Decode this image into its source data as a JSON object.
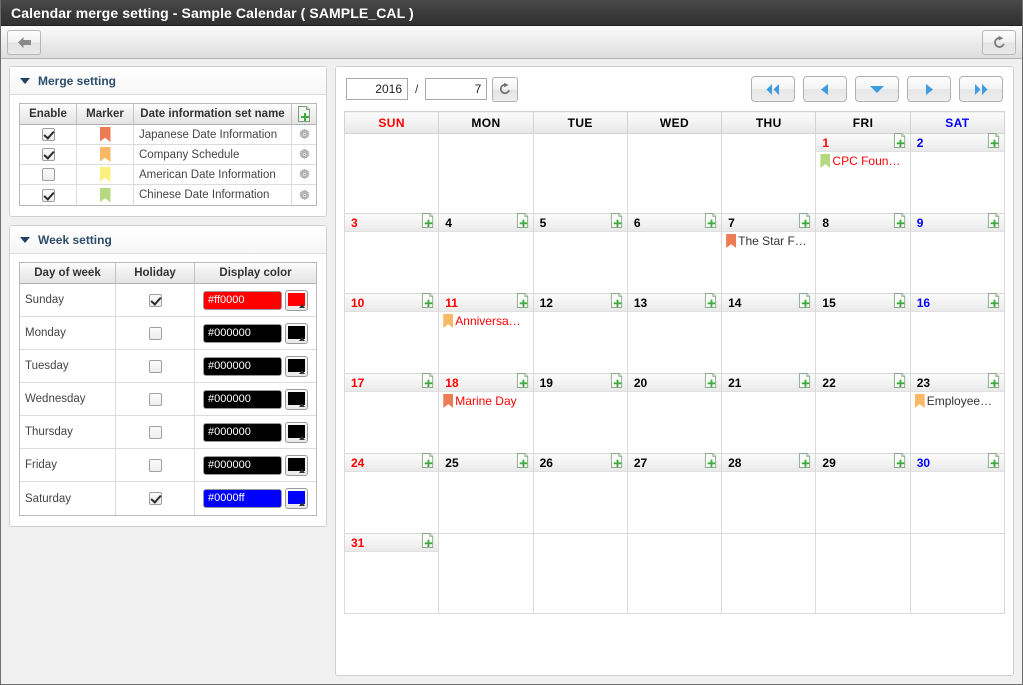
{
  "window": {
    "title": "Calendar merge setting - Sample Calendar ( SAMPLE_CAL )"
  },
  "toolbar": {
    "back_icon": "back-arrow-icon",
    "refresh_icon": "refresh-icon"
  },
  "merge_panel": {
    "title": "Merge setting",
    "collapse_icon": "caret-down-icon",
    "new_icon": "new-document-icon",
    "columns": [
      "Enable",
      "Marker",
      "Date information set name"
    ],
    "rows": [
      {
        "enabled": true,
        "marker_color": "#ed7b53",
        "name": "Japanese Date Information",
        "settings_icon": "gear-icon"
      },
      {
        "enabled": true,
        "marker_color": "#f9b866",
        "name": "Company Schedule",
        "settings_icon": "gear-icon"
      },
      {
        "enabled": false,
        "marker_color": "#fbf07e",
        "name": "American Date Information",
        "settings_icon": "gear-icon"
      },
      {
        "enabled": true,
        "marker_color": "#b5d97f",
        "name": "Chinese Date Information",
        "settings_icon": "gear-icon"
      }
    ]
  },
  "week_panel": {
    "title": "Week setting",
    "collapse_icon": "caret-down-icon",
    "columns": [
      "Day of week",
      "Holiday",
      "Display color"
    ],
    "rows": [
      {
        "day": "Sunday",
        "holiday": true,
        "color_value": "#ff0000",
        "color": "#ff0000"
      },
      {
        "day": "Monday",
        "holiday": false,
        "color_value": "#000000",
        "color": "#000000"
      },
      {
        "day": "Tuesday",
        "holiday": false,
        "color_value": "#000000",
        "color": "#000000"
      },
      {
        "day": "Wednesday",
        "holiday": false,
        "color_value": "#000000",
        "color": "#000000"
      },
      {
        "day": "Thursday",
        "holiday": false,
        "color_value": "#000000",
        "color": "#000000"
      },
      {
        "day": "Friday",
        "holiday": false,
        "color_value": "#000000",
        "color": "#000000"
      },
      {
        "day": "Saturday",
        "holiday": true,
        "color_value": "#0000ff",
        "color": "#0000ff"
      }
    ]
  },
  "calendar": {
    "year": "2016",
    "month": "7",
    "reload_icon": "refresh-icon",
    "nav": [
      {
        "name": "first-button",
        "icon": "double-left-icon"
      },
      {
        "name": "previous-button",
        "icon": "left-icon"
      },
      {
        "name": "today-button",
        "icon": "down-icon"
      },
      {
        "name": "next-button",
        "icon": "right-icon"
      },
      {
        "name": "last-button",
        "icon": "double-right-icon"
      }
    ],
    "weekday_headers": [
      {
        "label": "SUN",
        "color": "#ff0000"
      },
      {
        "label": "MON",
        "color": "#000000"
      },
      {
        "label": "TUE",
        "color": "#000000"
      },
      {
        "label": "WED",
        "color": "#000000"
      },
      {
        "label": "THU",
        "color": "#000000"
      },
      {
        "label": "FRI",
        "color": "#000000"
      },
      {
        "label": "SAT",
        "color": "#0000ff"
      }
    ],
    "add_icon": "add-event-icon",
    "weeks": [
      [
        {
          "blank": true
        },
        {
          "blank": true
        },
        {
          "blank": true
        },
        {
          "blank": true
        },
        {
          "blank": true
        },
        {
          "day": "1",
          "color": "#ff0000",
          "events": [
            {
              "marker_color": "#b5d97f",
              "title": "CPC Foun…",
              "color": "#ff0000"
            }
          ]
        },
        {
          "day": "2",
          "color": "#0000ff",
          "events": []
        }
      ],
      [
        {
          "day": "3",
          "color": "#ff0000",
          "events": []
        },
        {
          "day": "4",
          "color": "#000000",
          "events": []
        },
        {
          "day": "5",
          "color": "#000000",
          "events": []
        },
        {
          "day": "6",
          "color": "#000000",
          "events": []
        },
        {
          "day": "7",
          "color": "#000000",
          "events": [
            {
              "marker_color": "#ed7b53",
              "title": "The Star F…",
              "color": "#333333"
            }
          ]
        },
        {
          "day": "8",
          "color": "#000000",
          "events": []
        },
        {
          "day": "9",
          "color": "#0000ff",
          "events": []
        }
      ],
      [
        {
          "day": "10",
          "color": "#ff0000",
          "events": []
        },
        {
          "day": "11",
          "color": "#ff0000",
          "events": [
            {
              "marker_color": "#f9b866",
              "title": "Anniversa…",
              "color": "#ff0000"
            }
          ]
        },
        {
          "day": "12",
          "color": "#000000",
          "events": []
        },
        {
          "day": "13",
          "color": "#000000",
          "events": []
        },
        {
          "day": "14",
          "color": "#000000",
          "events": []
        },
        {
          "day": "15",
          "color": "#000000",
          "events": []
        },
        {
          "day": "16",
          "color": "#0000ff",
          "events": []
        }
      ],
      [
        {
          "day": "17",
          "color": "#ff0000",
          "events": []
        },
        {
          "day": "18",
          "color": "#ff0000",
          "events": [
            {
              "marker_color": "#ed7b53",
              "title": "Marine Day",
              "color": "#ff0000"
            }
          ]
        },
        {
          "day": "19",
          "color": "#000000",
          "events": []
        },
        {
          "day": "20",
          "color": "#000000",
          "events": []
        },
        {
          "day": "21",
          "color": "#000000",
          "events": []
        },
        {
          "day": "22",
          "color": "#000000",
          "events": []
        },
        {
          "day": "23",
          "color": "#000000",
          "events": [
            {
              "marker_color": "#f9b866",
              "title": "Employee…",
              "color": "#333333"
            }
          ]
        }
      ],
      [
        {
          "day": "24",
          "color": "#ff0000",
          "events": []
        },
        {
          "day": "25",
          "color": "#000000",
          "events": []
        },
        {
          "day": "26",
          "color": "#000000",
          "events": []
        },
        {
          "day": "27",
          "color": "#000000",
          "events": []
        },
        {
          "day": "28",
          "color": "#000000",
          "events": []
        },
        {
          "day": "29",
          "color": "#000000",
          "events": []
        },
        {
          "day": "30",
          "color": "#0000ff",
          "events": []
        }
      ],
      [
        {
          "day": "31",
          "color": "#ff0000",
          "events": []
        },
        {
          "blank": true
        },
        {
          "blank": true
        },
        {
          "blank": true
        },
        {
          "blank": true
        },
        {
          "blank": true
        },
        {
          "blank": true
        }
      ]
    ]
  }
}
